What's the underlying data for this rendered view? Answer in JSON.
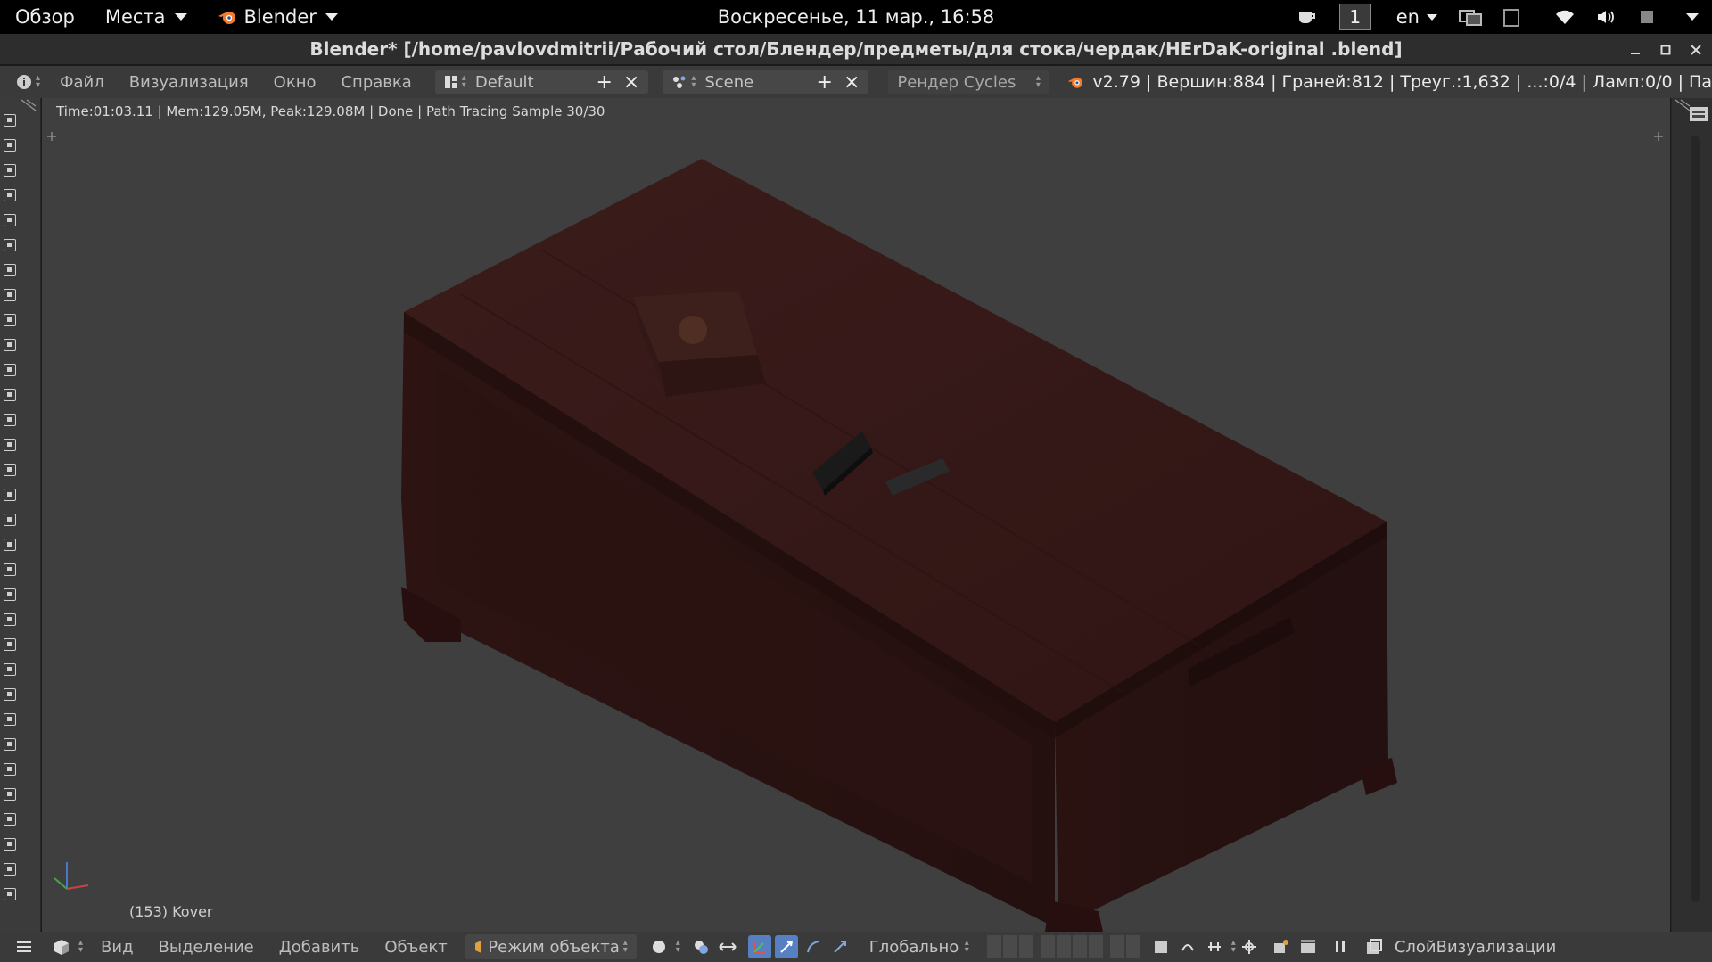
{
  "topbar": {
    "activities": "Обзор",
    "places": "Места",
    "app": "Blender",
    "datetime": "Воскресенье, 11 мар., 16:58",
    "workspace": "1",
    "lang": "en",
    "tray_icons": [
      "cup-icon",
      "network-manager-icon",
      "clipboard-icon",
      "wifi-icon",
      "volume-icon",
      "power-icon"
    ]
  },
  "window": {
    "title": "Blender* [/home/pavlovdmitrii/Рабочий стол/Блендер/предметы/для стока/чердак/HErDaK-original .blend]"
  },
  "info_header": {
    "menus": [
      "Файл",
      "Визуализация",
      "Окно",
      "Справка"
    ],
    "screen_layout": "Default",
    "scene": "Scene",
    "render_engine": "Рендер Cycles",
    "stats": "v2.79 | Вершин:884 | Граней:812 | Треуг.:1,632 | ...:0/4 | Ламп:0/0 | Па"
  },
  "viewport": {
    "render_status": "Time:01:03.11 | Mem:129.05M, Peak:129.08M | Done | Path Tracing Sample 30/30",
    "object_label": "(153) Kover",
    "background": "#3f3f3f"
  },
  "view_header": {
    "menus": [
      "Вид",
      "Выделение",
      "Добавить",
      "Объект"
    ],
    "mode": "Режим объекта",
    "orientation": "Глобально",
    "layer": "СлойВизуализации"
  },
  "colors": {
    "accent": "#5680c2",
    "header_bg": "#3a3a3a",
    "wood": "#3a1a19"
  }
}
